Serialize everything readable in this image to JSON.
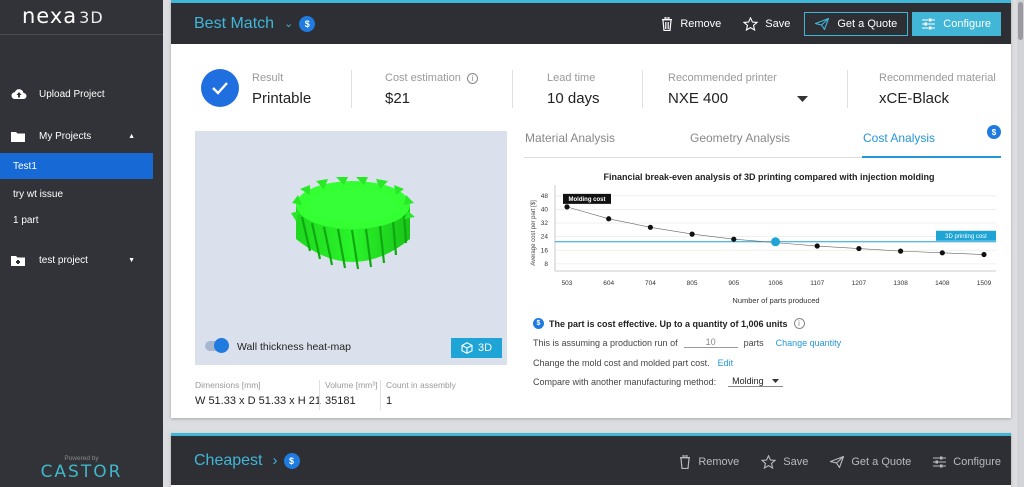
{
  "brand": {
    "logo": "nexa",
    "logo_suffix": "3D",
    "powered_by": "Powered by",
    "castor": "CASTOR"
  },
  "sidebar": {
    "items": [
      {
        "label": "Upload Project",
        "icon": "cloud-upload-icon"
      },
      {
        "label": "My Projects",
        "icon": "folder-icon",
        "caret": "▲"
      },
      {
        "label": "test project",
        "icon": "folder-plus-icon",
        "caret": "▼"
      }
    ],
    "sub_items": [
      {
        "label": "Test1",
        "active": true
      },
      {
        "label": "try wt issue",
        "active": false
      },
      {
        "label": "1 part",
        "active": false
      }
    ]
  },
  "card1": {
    "title": "Best Match",
    "chevron": "⌄",
    "dollar": "$",
    "actions": {
      "remove": "Remove",
      "save": "Save",
      "quote": "Get a Quote",
      "configure": "Configure"
    },
    "summary": {
      "result_cap": "Result",
      "result": "Printable",
      "cost_cap": "Cost estimation",
      "cost": "$21",
      "lead_cap": "Lead time",
      "lead": "10 days",
      "printer_cap": "Recommended printer",
      "printer": "NXE 400",
      "material_cap": "Recommended material",
      "material": "xCE-Black"
    },
    "viewer": {
      "heatmap_label": "Wall thickness heat-map",
      "button_3d": "3D",
      "gear_color": "#22ee22"
    },
    "props": {
      "dim_cap": "Dimensions [mm]",
      "dim": "W 51.33 x D 51.33 x H 21",
      "vol_cap": "Volume [mm³]",
      "vol": "35181",
      "count_cap": "Count in assembly",
      "count": "1"
    },
    "tabs": [
      "Material Analysis",
      "Geometry Analysis",
      "Cost Analysis"
    ],
    "active_tab": "Cost Analysis",
    "cost": {
      "effective": "The part is cost effective. Up to a quantity of 1,006 units",
      "assuming": "This is assuming a production run of",
      "run_value": "10",
      "parts": "parts",
      "change_qty": "Change quantity",
      "mold_text": "Change the mold cost and molded part cost.",
      "edit": "Edit",
      "compare_text": "Compare with another manufacturing method:",
      "method": "Molding"
    }
  },
  "card2": {
    "title": "Cheapest",
    "chevron": "›",
    "dollar": "$",
    "actions": {
      "remove": "Remove",
      "save": "Save",
      "quote": "Get a Quote",
      "configure": "Configure"
    }
  },
  "colors": {
    "accent": "#41b6d6",
    "primary": "#1f7be0",
    "sidebar": "#323338"
  },
  "chart_data": {
    "type": "line",
    "title": "Financial break-even analysis of 3D printing compared with injection molding",
    "xlabel": "Number of parts produced",
    "ylabel": "Average cost per part [$]",
    "categories": [
      "503",
      "604",
      "704",
      "805",
      "905",
      "1006",
      "1107",
      "1207",
      "1308",
      "1408",
      "1509"
    ],
    "y_ticks": [
      "8",
      "16",
      "24",
      "32",
      "40",
      "48"
    ],
    "ylim": [
      5,
      52
    ],
    "series": [
      {
        "name": "Molding cost",
        "values": [
          41.5,
          34.5,
          29.5,
          25.5,
          22.5,
          20.5,
          18.5,
          17,
          15.5,
          14.5,
          13.5
        ]
      },
      {
        "name": "3D printing cost",
        "values": [
          21,
          21,
          21,
          21,
          21,
          21,
          21,
          21,
          21,
          21,
          21
        ]
      }
    ],
    "break_even_index": 5,
    "colors": {
      "molding": "#111111",
      "printing": "#1fa4d6"
    }
  }
}
